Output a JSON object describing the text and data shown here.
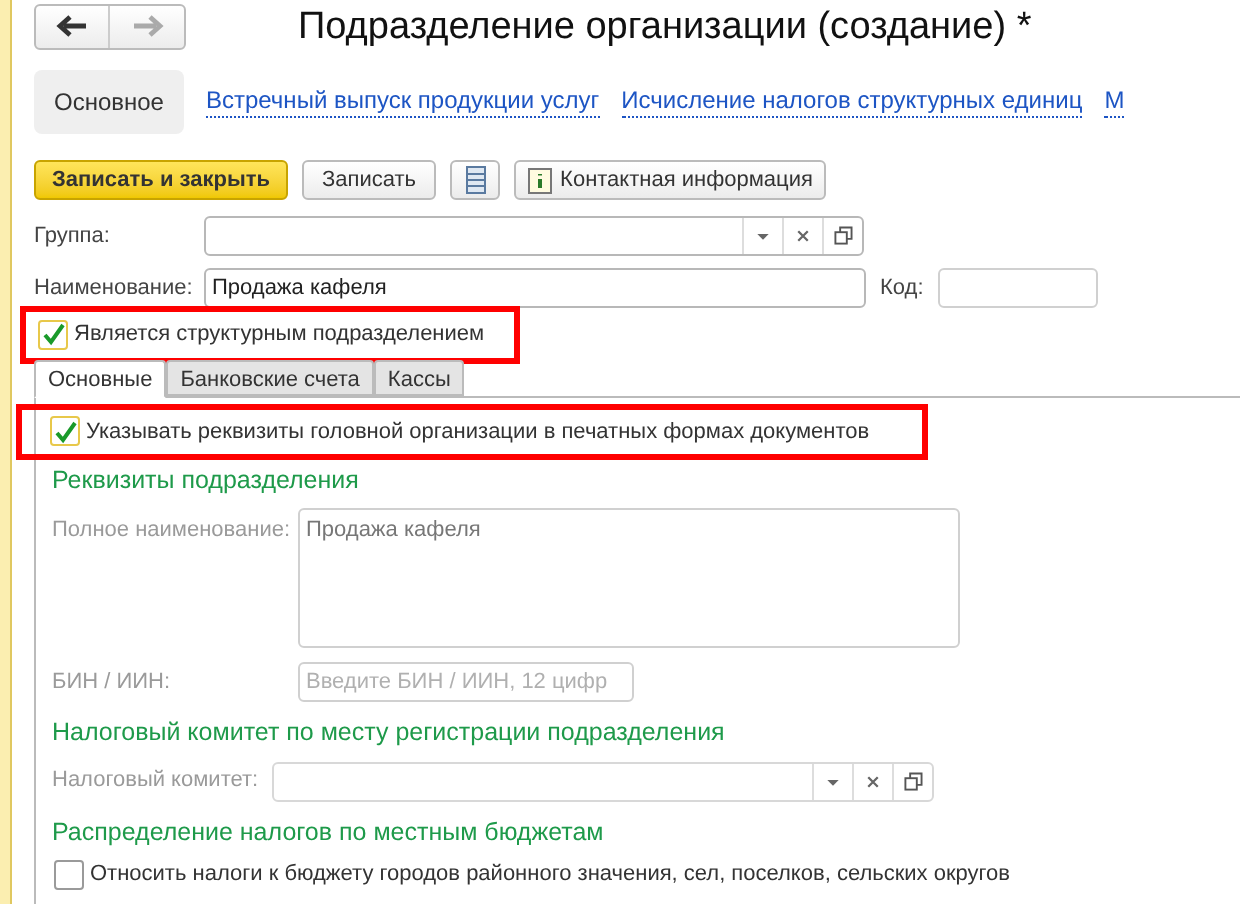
{
  "window": {
    "title": "Подразделение организации (создание) *"
  },
  "nav": {
    "back_disabled": false,
    "forward_disabled": true
  },
  "sections": [
    {
      "label": "Основное",
      "selected": true
    },
    {
      "label": "Встречный выпуск продукции услуг",
      "selected": false
    },
    {
      "label": "Исчисление налогов структурных единиц",
      "selected": false
    },
    {
      "label": "М",
      "selected": false
    }
  ],
  "toolbar": [
    {
      "kind": "primary",
      "label": "Записать и закрыть"
    },
    {
      "kind": "plain",
      "label": "Записать"
    },
    {
      "kind": "icon"
    },
    {
      "kind": "info",
      "label": "Контактная информация"
    }
  ],
  "group": {
    "label": "Группа:"
  },
  "name": {
    "label": "Наименование:",
    "value": "Продажа кафеля"
  },
  "code": {
    "label": "Код:"
  },
  "structural": {
    "label": "Является структурным подразделением",
    "checked": true,
    "highlighted": true
  },
  "tabs": [
    {
      "label": "Основные",
      "selected": true
    },
    {
      "label": "Банковские счета",
      "selected": false
    },
    {
      "label": "Кассы",
      "selected": false
    }
  ],
  "print_head": {
    "label": "Указывать реквизиты головной организации в печатных формах документов",
    "checked": true,
    "highlighted": true
  },
  "details": {
    "heading": "Реквизиты подразделения",
    "disabled": true,
    "full_name": {
      "label": "Полное наименование:",
      "value": "Продажа кафеля"
    },
    "bin": {
      "label": "БИН / ИИН:",
      "placeholder": "Введите БИН / ИИН, 12 цифр"
    }
  },
  "tax_committee": {
    "heading": "Налоговый комитет по месту регистрации подразделения",
    "disabled": true,
    "label": "Налоговый комитет:"
  },
  "local_budgets": {
    "heading": "Распределение налогов по местным бюджетам",
    "option": {
      "label": "Относить налоги к бюджету городов районного значения, сел, поселков, сельских округов",
      "checked": false
    }
  }
}
